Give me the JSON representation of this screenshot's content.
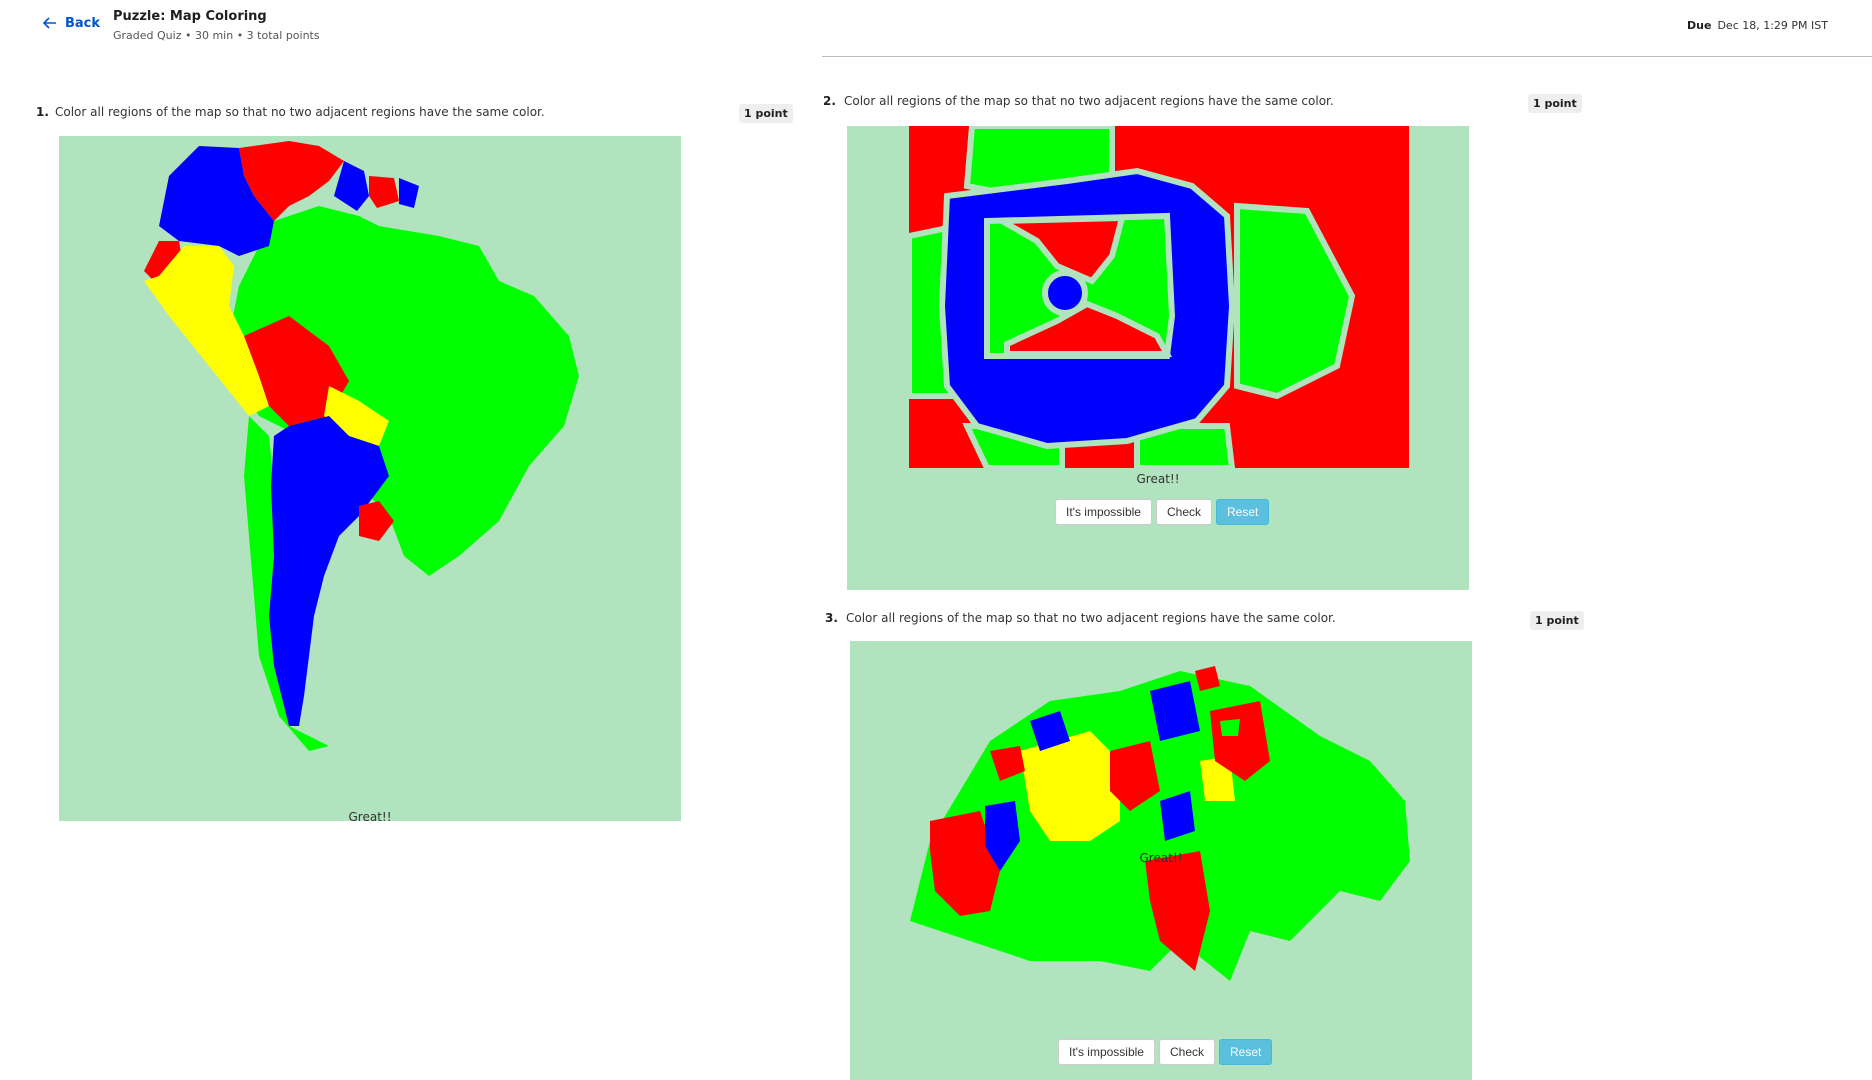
{
  "header": {
    "back_label": "Back",
    "title": "Puzzle: Map Coloring",
    "subtitle": "Graded Quiz • 30 min • 3 total points",
    "due_label": "Due",
    "due_value": "Dec 18, 1:29 PM IST"
  },
  "colors": {
    "red": "#ff0000",
    "green": "#00ff00",
    "blue": "#0000ff",
    "yellow": "#ffff00",
    "map_bg": "#b1e3be"
  },
  "questions": [
    {
      "number": "1.",
      "text": "Color all regions of the map so that no two adjacent regions have the same color.",
      "points": "1 point",
      "status": "Great!!"
    },
    {
      "number": "2.",
      "text": "Color all regions of the map so that no two adjacent regions have the same color.",
      "points": "1 point",
      "status": "Great!!",
      "buttons": {
        "impossible": "It's impossible",
        "check": "Check",
        "reset": "Reset"
      }
    },
    {
      "number": "3.",
      "text": "Color all regions of the map so that no two adjacent regions have the same color.",
      "points": "1 point",
      "status": "Great!!",
      "buttons": {
        "impossible": "It's impossible",
        "check": "Check",
        "reset": "Reset"
      }
    }
  ]
}
